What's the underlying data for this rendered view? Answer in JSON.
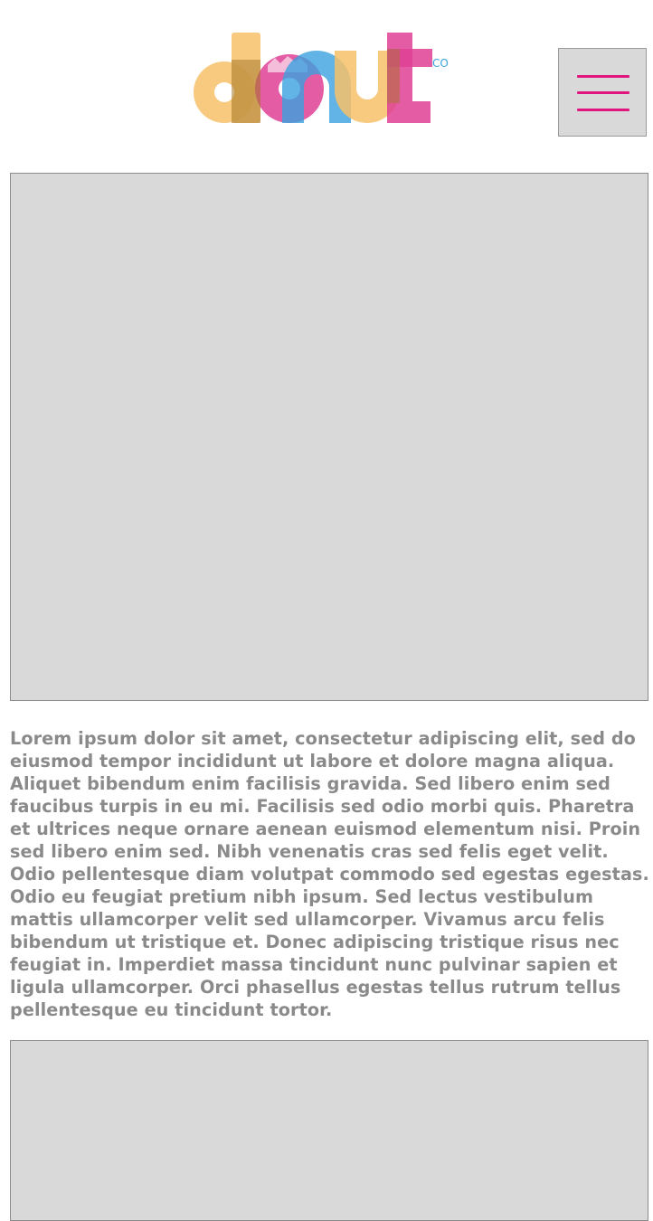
{
  "header": {
    "logo_alt": "donut co.",
    "logo_suffix": "CO.",
    "menu_icon": "hamburger-menu-icon"
  },
  "main": {
    "hero_image_icon": "image-placeholder",
    "paragraph": "Lorem ipsum dolor sit amet, consectetur adipiscing elit, sed do eiusmod tempor incididunt ut labore et dolore magna aliqua. Aliquet bibendum enim facilisis gravida. Sed libero enim sed faucibus turpis in eu mi. Facilisis sed odio morbi quis. Pharetra et ultrices neque ornare aenean euismod elementum nisi. Proin sed libero enim sed. Nibh venenatis cras sed felis eget velit. Odio pellentesque diam volutpat commodo sed egestas egestas. Odio eu feugiat pretium nibh ipsum. Sed lectus vestibulum mattis ullamcorper velit sed ullamcorper. Vivamus arcu felis bibendum ut tristique et. Donec adipiscing tristique risus nec feugiat in. Imperdiet massa tincidunt nunc pulvinar sapien et ligula ullamcorper. Orci phasellus egestas tellus rutrum tellus pellentesque eu tincidunt tortor.",
    "second_image_icon": "image-placeholder"
  },
  "colors": {
    "yellow": "#f7c16a",
    "pink": "#de3f94",
    "blue": "#3aa1de",
    "brown": "#a57a2f",
    "placeholder_gray": "#d9d9d9",
    "text_gray": "#8a8a8a",
    "menu_bar_pink": "#e0157d"
  }
}
